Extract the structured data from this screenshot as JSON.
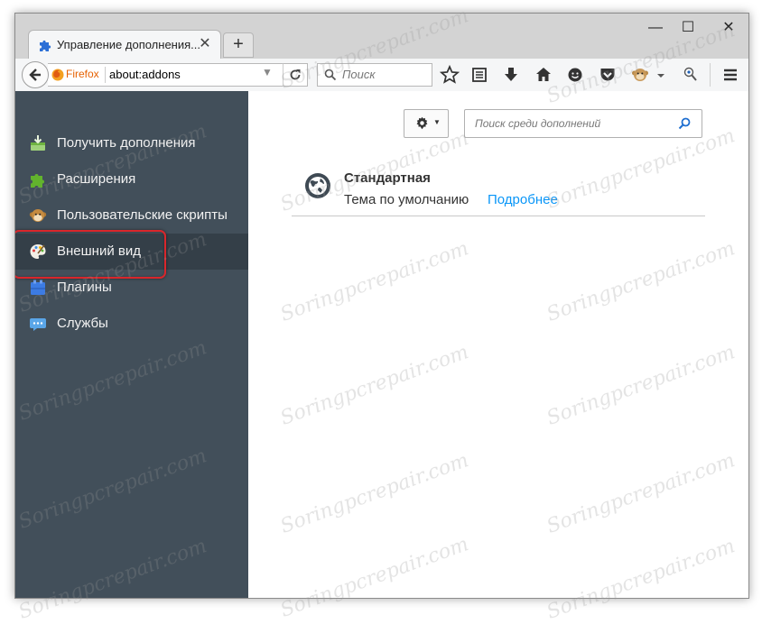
{
  "tab": {
    "title": "Управление дополнения...",
    "close": "✕"
  },
  "new_tab_symbol": "+",
  "window_controls": {
    "minimize": "—",
    "maximize": "☐",
    "close": "✕"
  },
  "navbar": {
    "identity_label": "Firefox",
    "url": "about:addons",
    "search_placeholder": "Поиск"
  },
  "toolbar_icons": [
    "bookmark-star-icon",
    "reading-list-icon",
    "download-icon",
    "home-icon",
    "smiley-icon",
    "pocket-icon",
    "monkey-addon-icon",
    "menu-dropdown-icon",
    "pin-addon-icon",
    "hamburger-menu-icon"
  ],
  "sidebar": {
    "items": [
      {
        "label": "Получить дополнения",
        "icon": "get-addons-icon",
        "selected": false
      },
      {
        "label": "Расширения",
        "icon": "puzzle-icon",
        "selected": false
      },
      {
        "label": "Пользовательские скрипты",
        "icon": "monkey-icon",
        "selected": false
      },
      {
        "label": "Внешний вид",
        "icon": "palette-icon",
        "selected": true
      },
      {
        "label": "Плагины",
        "icon": "plugin-icon",
        "selected": false
      },
      {
        "label": "Службы",
        "icon": "services-icon",
        "selected": false
      }
    ]
  },
  "main": {
    "search_placeholder": "Поиск среди дополнений",
    "theme": {
      "name": "Стандартная",
      "description": "Тема по умолчанию",
      "more_link": "Подробнее"
    }
  },
  "watermark": "Soringpcrepair.com",
  "colors": {
    "sidebar_bg": "#424f5a",
    "sidebar_selected": "#343f48",
    "link": "#0996f8",
    "highlight_border": "#d9262b",
    "firefox_orange": "#e66000"
  }
}
